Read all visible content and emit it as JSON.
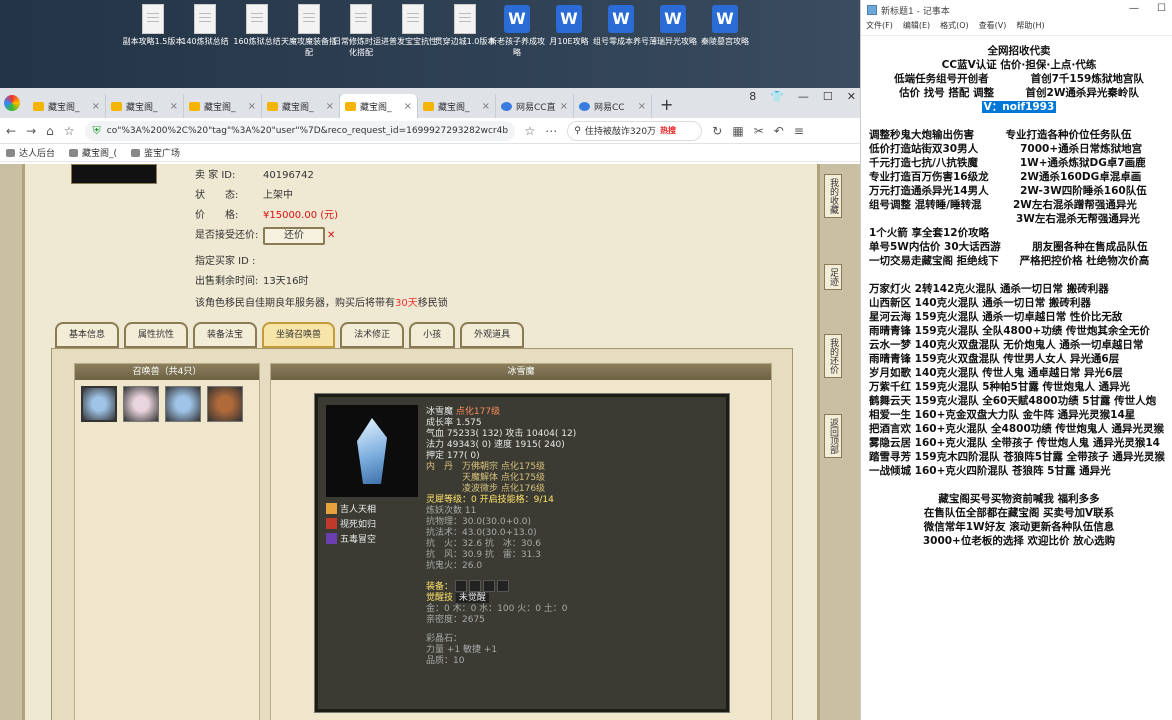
{
  "desktop": {
    "icons": [
      {
        "label": "副本攻略1.5版本",
        "type": "doc"
      },
      {
        "label": "140炼狱总结",
        "type": "doc"
      },
      {
        "label": "160炼狱总结",
        "type": "doc"
      },
      {
        "label": "天魔攻魔装备搭配",
        "type": "doc"
      },
      {
        "label": "日常修炼时运进化搭配",
        "type": "doc"
      },
      {
        "label": "普发宝宝抗性",
        "type": "doc"
      },
      {
        "label": "贯穿边城1.0版本",
        "type": "doc"
      },
      {
        "label": "新老孩子养成攻略",
        "type": "word"
      },
      {
        "label": "月10E攻略",
        "type": "word"
      },
      {
        "label": "组号零成本养号",
        "type": "word"
      },
      {
        "label": "薄瑞异光攻略",
        "type": "word"
      },
      {
        "label": "秦陵墓宫攻略",
        "type": "word"
      }
    ]
  },
  "browser": {
    "tabs": [
      {
        "label": "藏宝阁_",
        "active": false,
        "icon": "treasure-icon"
      },
      {
        "label": "藏宝阁_",
        "active": false,
        "icon": "treasure-icon"
      },
      {
        "label": "藏宝阁_",
        "active": false,
        "icon": "treasure-icon"
      },
      {
        "label": "藏宝阁_",
        "active": false,
        "icon": "treasure-icon"
      },
      {
        "label": "藏宝阁_",
        "active": true,
        "icon": "treasure-icon"
      },
      {
        "label": "藏宝阁_",
        "active": false,
        "icon": "treasure-icon"
      },
      {
        "label": "网易CC直",
        "active": false,
        "icon": "netease-icon"
      },
      {
        "label": "网易CC",
        "active": false,
        "icon": "netease-icon"
      }
    ],
    "tab_count": "8",
    "url": "co\"%3A%200%2C%20\"tag\"%3A%20\"user\"%7D&reco_request_id=1699927293282wcr4b",
    "search_text": "住持被敲诈320万",
    "search_hot": "热搜",
    "bookmarks": [
      "达人后台",
      "藏宝阁_(",
      "鉴宝广场"
    ]
  },
  "listing": {
    "seller_label": "卖 家 ID:",
    "seller_id": "40196742",
    "status_label": "状　　态:",
    "status": "上架中",
    "price_label": "价　　格:",
    "price": "¥15000.00 (元)",
    "counter_label": "是否接受还价:",
    "counter_button": "还价",
    "buyer_label": "指定买家 ID :",
    "remaining_label": "出售剩余时间:",
    "remaining": "13天16时",
    "notice_pre": "该角色移民自佳期良年服务器，购买后将带有",
    "notice_days": "30天",
    "notice_post": "移民锁",
    "tabs": [
      "基本信息",
      "属性抗性",
      "装备法宝",
      "坐骑召唤兽",
      "法术修正",
      "小孩",
      "外观道具"
    ],
    "active_tab": 3
  },
  "pets_panel": {
    "title": "召唤兽（共4只）",
    "pets": [
      {
        "name": "冰雪魔",
        "color": "#9fc4e8",
        "selected": true
      },
      {
        "name": "pet2",
        "color": "#e9d5dd",
        "selected": false
      },
      {
        "name": "pet3",
        "color": "#9fc4e8",
        "selected": false
      },
      {
        "name": "pet4",
        "color": "#b06a3a",
        "selected": false
      }
    ]
  },
  "pet_detail": {
    "header": "冰雪魔",
    "name": "冰雪魔",
    "name_extra": "点化177级",
    "lines": [
      "成长率 1.575",
      "气血 75233( 132) 攻击 10404( 12)",
      "法力 49343( 0) 速度 1915( 240)",
      "押定 177( 0)"
    ],
    "mod_lines": [
      "内　丹　万佛朝宗 点化175级",
      "　　　　天魔解体 点化175级",
      "　　　　凌波微步 点化176级"
    ],
    "spirit": "灵犀等级：0 开启技能格：9/14",
    "refine": "炼妖次数 11",
    "resist": [
      "抗物理：30.0(30.0+0.0)",
      "抗法术：43.0(30.0+13.0)",
      "抗　火：32.6 抗　冰：30.6",
      "抗　风：30.9 抗　雷：31.3",
      "抗鬼火：26.0"
    ],
    "equip_label": "装备：",
    "awaken_label": "觉醒技",
    "awaken_value": "未觉醒",
    "five": [
      "金：0 木：0 水：100 火：0 土：0",
      "亲密度：2675"
    ],
    "color_label": "彩晶石：",
    "color_lines": [
      "力量 +1 敏捷 +1",
      "品质：10"
    ],
    "skills": [
      {
        "name": "吉人天相",
        "color": "#e6a23c"
      },
      {
        "name": "视死如归",
        "color": "#c0392b"
      },
      {
        "name": "五毒冒空",
        "color": "#6c3fb0"
      }
    ]
  },
  "side_buttons": [
    "我的收藏",
    "足迹",
    "我的还价",
    "返回顶部"
  ],
  "notepad": {
    "title": "新标题1 - 记事本",
    "menu": [
      "文件(F)",
      "编辑(E)",
      "格式(O)",
      "查看(V)",
      "帮助(H)"
    ],
    "top_lines": [
      "全网招收代卖",
      "CC蓝V认证 估价·担保·上点·代练",
      "低端任务组号开创者　　　　首创7千159炼狱地宫队",
      "估价 找号 搭配 调整　　　首创2W通杀异光秦岭队"
    ],
    "contact": "V：noif1993",
    "lines": [
      "调整秒鬼大炮输出伤害　　　专业打造各种价位任务队伍",
      "低价打造站街双30男人　　　　7000+通杀日常炼狱地宫",
      "千元打造七抗/八抗铁魔　　　　1W+通杀炼狱DG卓7画鹿",
      "专业打造百万伤害16级龙　　　2W通杀160DG卓混卓画",
      "万元打造通杀异光14男人　　　2W-3W四阶睡杀160队伍",
      "组号调整 混转睡/睡转混　　　2W左右混杀蹭帮强通异光",
      "　　　　　　　　　　　　　　3W左右混杀无帮强通异光",
      "1个火箭 享全套12价攻略",
      "单号5W内估价 30大话西游　　　朋友圈各种在售成品队伍",
      "一切交易走藏宝阁 拒绝线下　　严格把控价格 杜绝物次价高",
      "",
      "万家灯火 2转142克火混队 通杀一切日常 搬砖利器",
      "山西新区 140克火混队 通杀一切日常 搬砖利器",
      "星河云海 159克火混队 通杀一切卓越日常 性价比无敌",
      "雨晴青锋 159克火混队 全队4800+功绩 传世炮其余全无价",
      "云水一梦 140克火双盘混队 无价炮鬼人 通杀一切卓越日常",
      "雨晴青锋 159克火双盘混队 传世男人女人 异光通6层",
      "岁月如歌 140克火混队 传世人鬼 通卓越日常 异光6层",
      "万紫千红 159克火混队 5种帕5甘露 传世炮鬼人 通异光",
      "鹤舞云天 159克火混队 全60天赋4800功绩 5甘露 传世人炮",
      "相爱一生 160+克金双盘大力队 金牛阵 通异光灵猴14星",
      "把酒言欢 160+克火混队 全4800功绩 传世炮鬼人 通异光灵猴",
      "雾隐云居 160+克火混队 全带孩子 传世炮人鬼 通异光灵猴14",
      "踏雪寻芳 159克木四阶混队 苍狼阵5甘露 全带孩子 通异光灵猴",
      "一战倾城 160+克火四阶混队 苍狼阵 5甘露 通异光",
      ""
    ],
    "bottom_lines": [
      "藏宝阁买号买物资前喊我 福利多多",
      "在售队伍全部都在藏宝阁 买卖号加V联系",
      "微信常年1W好友 滚动更新各种队伍信息",
      "3000+位老板的选择 欢迎比价 放心选购"
    ]
  }
}
